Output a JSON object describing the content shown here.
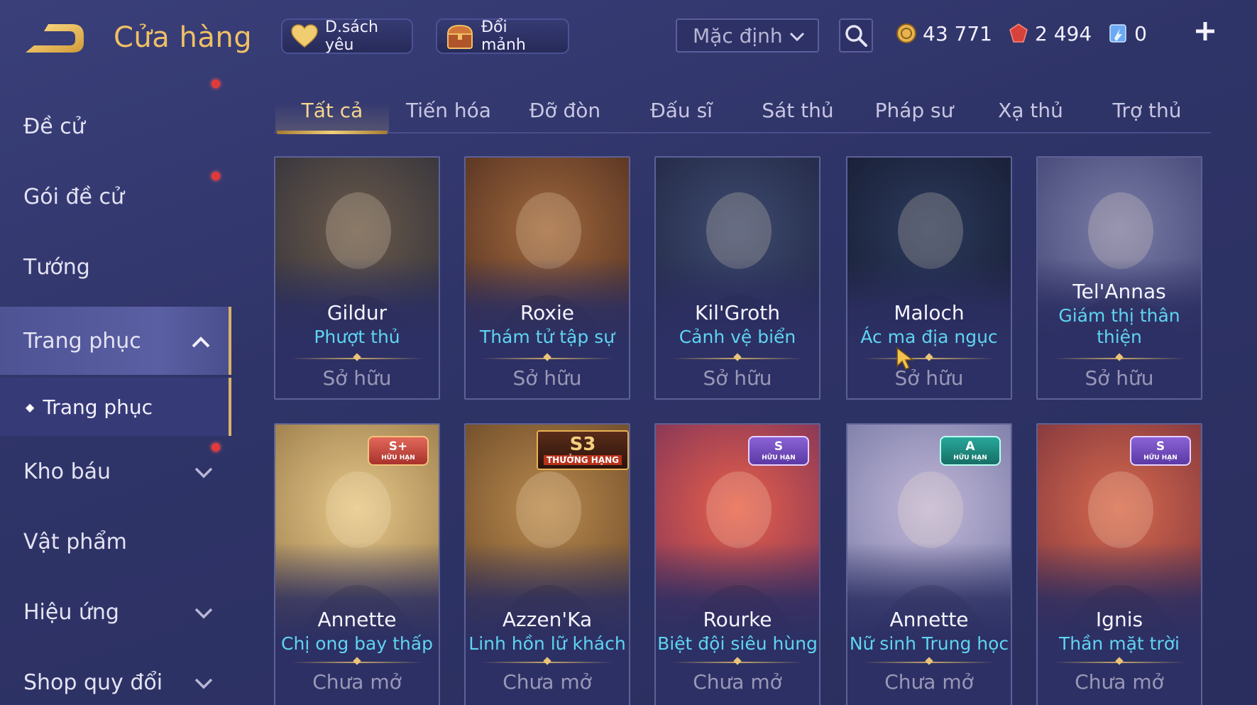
{
  "header": {
    "title": "Cửa hàng",
    "favorites_label": "D.sách yêu",
    "exchange_label": "Đổi mảnh",
    "sort_value": "Mặc định",
    "currencies": [
      {
        "name": "gold",
        "value": "43 771",
        "icon": "gold-coin-icon",
        "color": "#f0c064"
      },
      {
        "name": "voucher",
        "value": "2 494",
        "icon": "red-gem-icon",
        "color": "#e2504c"
      },
      {
        "name": "diamond",
        "value": "0",
        "icon": "blue-crystal-icon",
        "color": "#7fc8ff"
      }
    ]
  },
  "sidebar": {
    "items": [
      {
        "label": "Đề cử",
        "notification": false
      },
      {
        "label": "Gói đề cử",
        "notification": true
      },
      {
        "label": "Tướng",
        "notification": false
      },
      {
        "label": "Trang phục",
        "notification": false,
        "expanded": true
      },
      {
        "label": "Trang phục",
        "sub": true
      },
      {
        "label": "Kho báu",
        "notification": true
      },
      {
        "label": "Vật phẩm",
        "notification": false
      },
      {
        "label": "Hiệu ứng",
        "notification": false
      },
      {
        "label": "Shop quy đổi",
        "notification": false
      }
    ]
  },
  "tabs": [
    "Tất cả",
    "Tiến hóa",
    "Đỡ đòn",
    "Đấu sĩ",
    "Sát thủ",
    "Pháp sư",
    "Xạ thủ",
    "Trợ thủ"
  ],
  "active_tab": "Tất cả",
  "cards": [
    {
      "hero": "Gildur",
      "skin": "Phượt thủ",
      "status": "Sở hữu",
      "badge": null,
      "badge_sub": null,
      "palette": [
        "#6b5a4a",
        "#2b2d3a"
      ]
    },
    {
      "hero": "Roxie",
      "skin": "Thám tử tập sự",
      "status": "Sở hữu",
      "badge": null,
      "badge_sub": null,
      "palette": [
        "#a0683c",
        "#4a2a1e"
      ]
    },
    {
      "hero": "Kil'Groth",
      "skin": "Cảnh vệ biển",
      "status": "Sở hữu",
      "badge": null,
      "badge_sub": null,
      "palette": [
        "#3d4a6e",
        "#1f2340"
      ]
    },
    {
      "hero": "Maloch",
      "skin": "Ác ma địa ngục",
      "status": "Sở hữu",
      "badge": null,
      "badge_sub": null,
      "palette": [
        "#2b3a5c",
        "#15192e"
      ]
    },
    {
      "hero": "Tel'Annas",
      "skin": "Giám thị thân thiện",
      "status": "Sở hữu",
      "badge": null,
      "badge_sub": null,
      "palette": [
        "#7c7ea8",
        "#3b3e6e"
      ]
    },
    {
      "hero": "Annette",
      "skin": "Chị ong bay thấp",
      "status": "Chưa mở",
      "badge": "S+",
      "badge_sub": "HỮU HẠN",
      "badge_class": "splus",
      "palette": [
        "#e6c98a",
        "#8a6a3c"
      ]
    },
    {
      "hero": "Azzen'Ka",
      "skin": "Linh hồn lữ khách",
      "status": "Chưa mở",
      "badge": "S3",
      "badge_sub": "THƯỞNG HẠNG",
      "badge_class": "s3",
      "palette": [
        "#b98a4e",
        "#5c3c20"
      ]
    },
    {
      "hero": "Rourke",
      "skin": "Biệt đội siêu hùng",
      "status": "Chưa mở",
      "badge": "S",
      "badge_sub": "HỮU HẠN",
      "badge_class": "s",
      "palette": [
        "#e8604a",
        "#6a2a5c"
      ]
    },
    {
      "hero": "Annette",
      "skin": "Nữ sinh Trung học",
      "status": "Chưa mở",
      "badge": "A",
      "badge_sub": "HỮU HẠN",
      "badge_class": "a",
      "palette": [
        "#c2b8d8",
        "#6a6e9c"
      ]
    },
    {
      "hero": "Ignis",
      "skin": "Thần mặt trời",
      "status": "Chưa mở",
      "badge": "S",
      "badge_sub": "HỮU HẠN",
      "badge_class": "s",
      "palette": [
        "#d86a4e",
        "#6c2a3a"
      ]
    }
  ]
}
